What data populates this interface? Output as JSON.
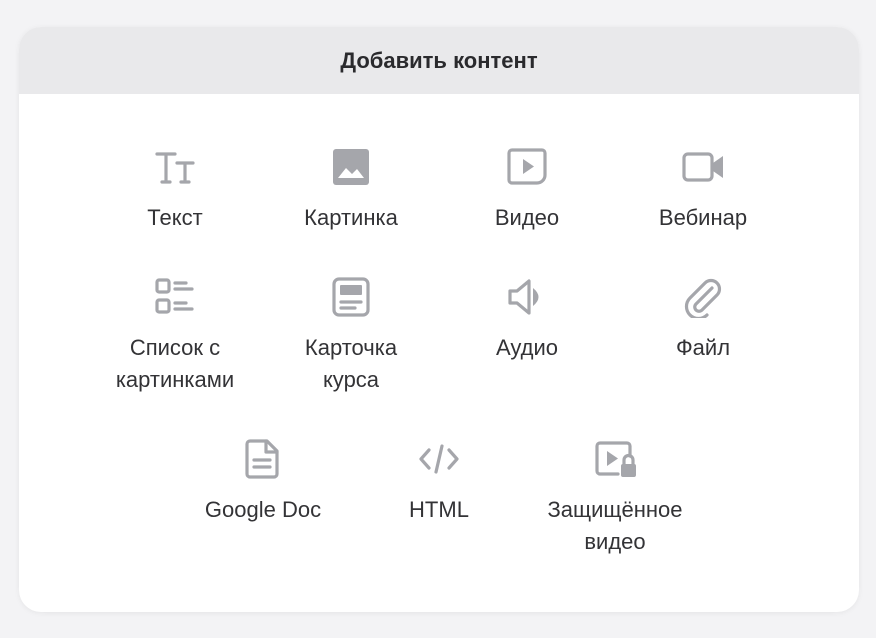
{
  "dialog": {
    "title": "Добавить контент",
    "items": [
      {
        "icon": "text-icon",
        "label": "Текст"
      },
      {
        "icon": "image-icon",
        "label": "Картинка"
      },
      {
        "icon": "video-icon",
        "label": "Видео"
      },
      {
        "icon": "webinar-camera-icon",
        "label": "Вебинар"
      },
      {
        "icon": "image-list-icon",
        "label": "Список с\nкартинками"
      },
      {
        "icon": "course-card-icon",
        "label": "Карточка\nкурса"
      },
      {
        "icon": "audio-speaker-icon",
        "label": "Аудио"
      },
      {
        "icon": "paperclip-icon",
        "label": "Файл"
      },
      {
        "icon": "document-icon",
        "label": "Google Doc"
      },
      {
        "icon": "code-icon",
        "label": "HTML"
      },
      {
        "icon": "protected-video-icon",
        "label": "Защищённое\nвидео"
      }
    ]
  }
}
